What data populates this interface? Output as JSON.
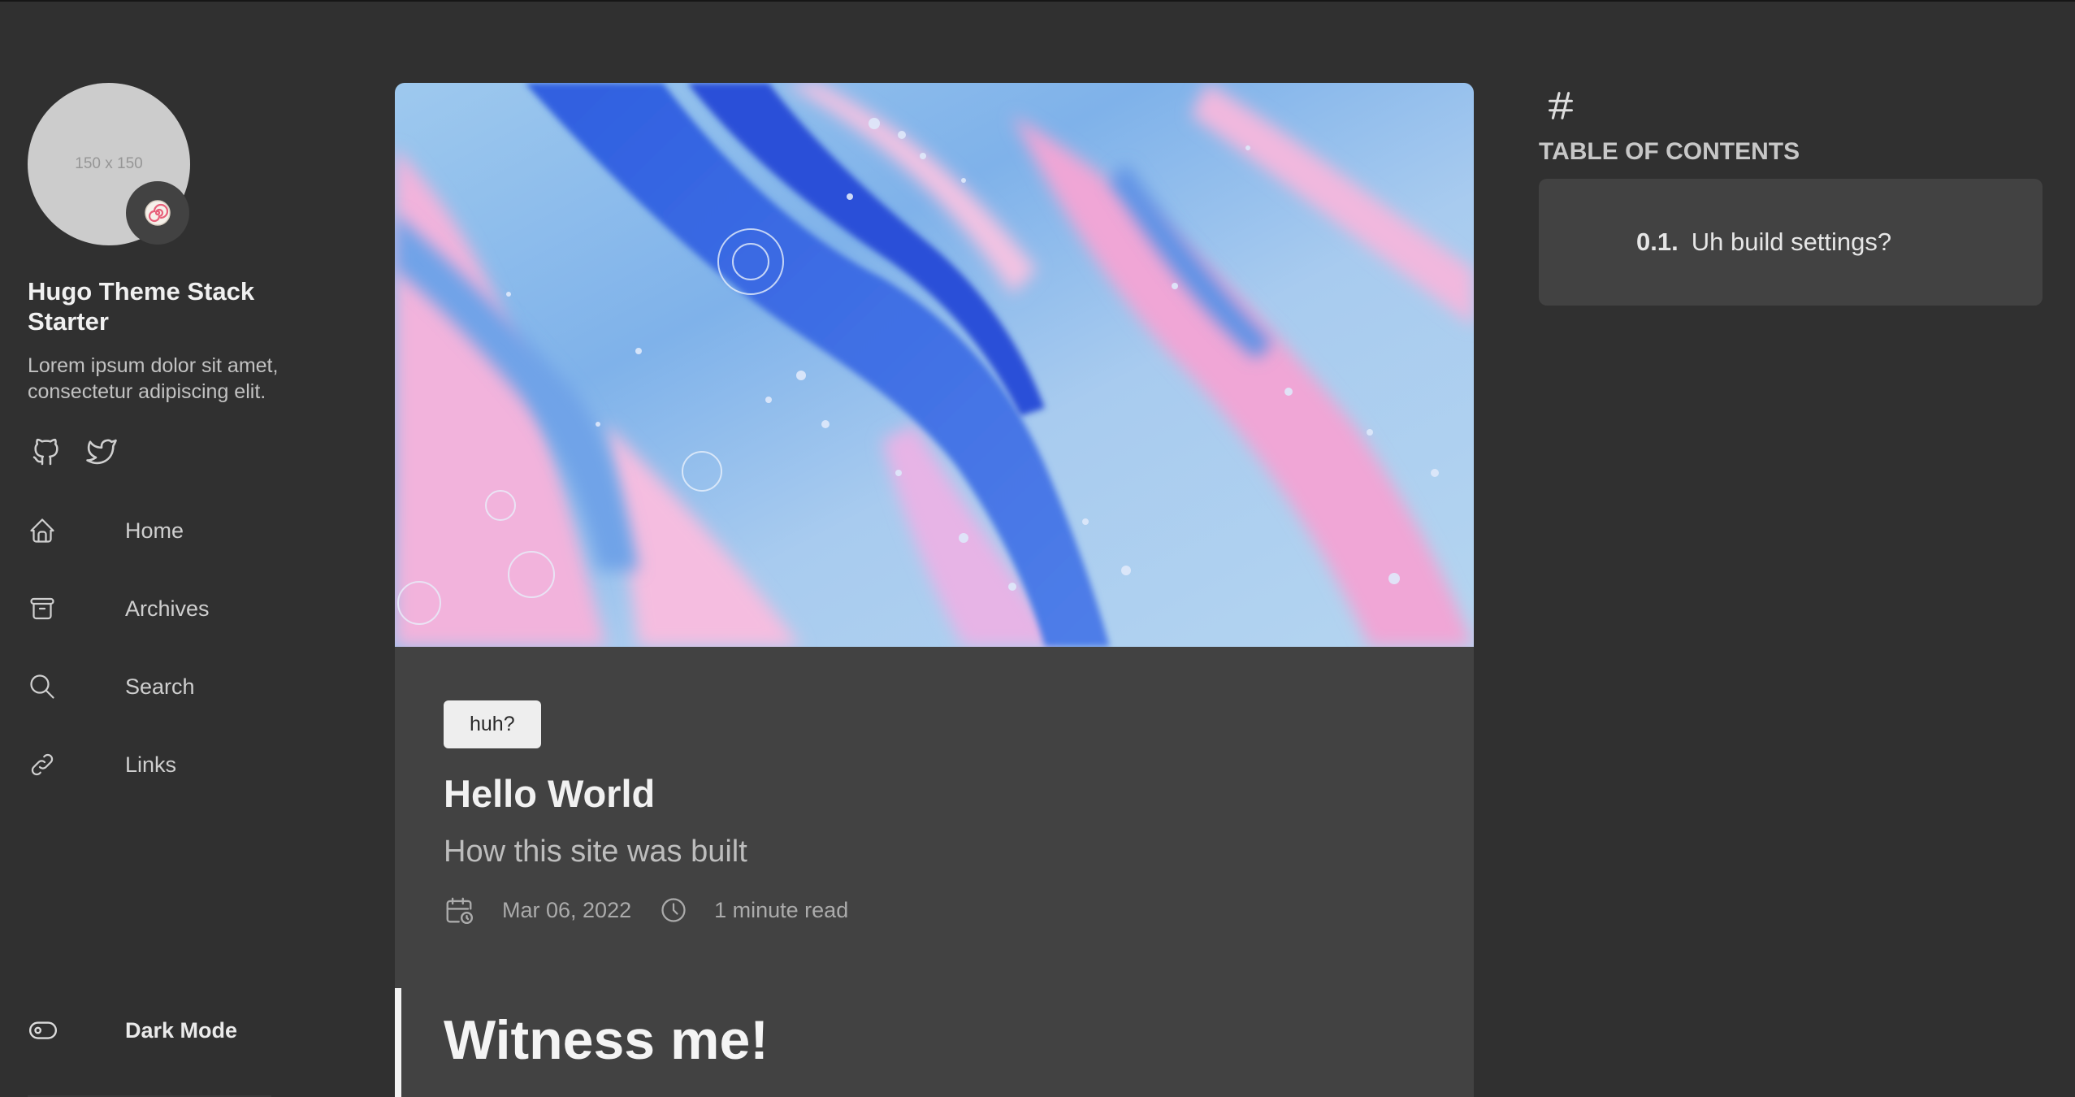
{
  "sidebar": {
    "avatar_placeholder": "150 x 150",
    "emoji": "🍥",
    "site_name": "Hugo Theme Stack Starter",
    "site_description": "Lorem ipsum dolor sit amet, consectetur adipiscing elit.",
    "social": [
      {
        "name": "GitHub",
        "icon": "github-icon"
      },
      {
        "name": "Twitter",
        "icon": "twitter-icon"
      }
    ],
    "menu": [
      {
        "label": "Home",
        "icon": "home-icon"
      },
      {
        "label": "Archives",
        "icon": "archive-icon"
      },
      {
        "label": "Search",
        "icon": "search-icon"
      },
      {
        "label": "Links",
        "icon": "link-icon"
      }
    ],
    "dark_mode_label": "Dark Mode"
  },
  "article": {
    "tag": "huh?",
    "title": "Hello World",
    "subtitle": "How this site was built",
    "date": "Mar 06, 2022",
    "reading_time": "1 minute read",
    "heading": "Witness me!"
  },
  "toc": {
    "hash": "#",
    "title": "TABLE OF CONTENTS",
    "items": [
      {
        "number": "0.1.",
        "label": "Uh build settings?"
      }
    ]
  },
  "colors": {
    "background": "#303030",
    "card": "#424242",
    "text": "#f1f1f1",
    "muted": "#ababab",
    "tag_bg": "#eeeeee"
  }
}
